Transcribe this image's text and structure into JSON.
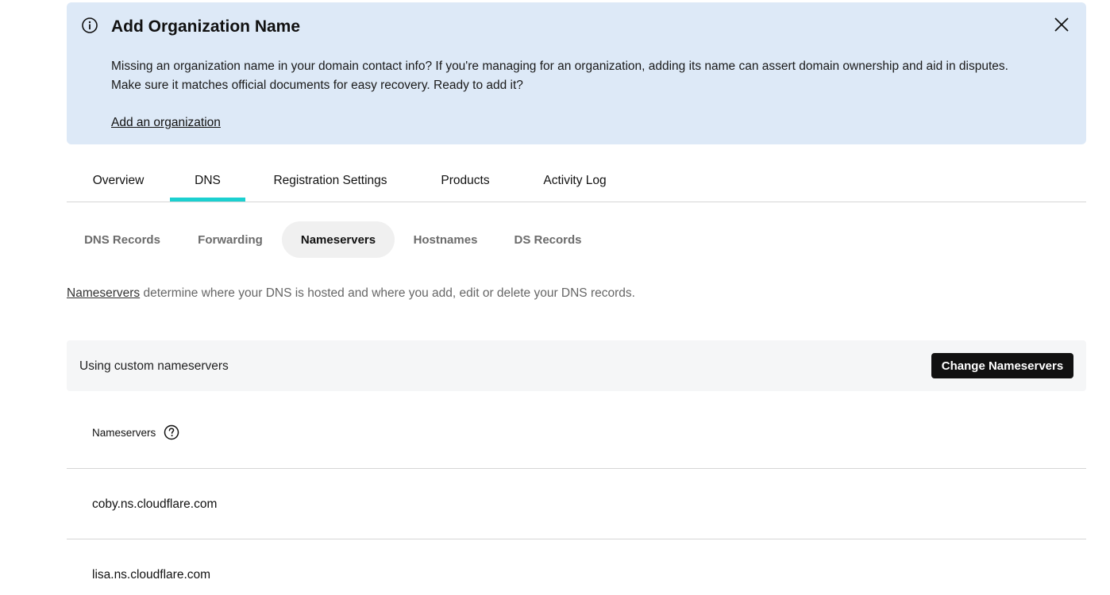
{
  "banner": {
    "title": "Add Organization Name",
    "body_line1": "Missing an organization name in your domain contact info? If you're managing for an organization, adding its name can assert domain ownership and aid in disputes.",
    "body_line2": "Make sure it matches official documents for easy recovery. Ready to add it?",
    "link": "Add an organization",
    "info_icon": "info-icon",
    "close_icon": "close-icon"
  },
  "tabs": [
    {
      "label": "Overview",
      "active": false
    },
    {
      "label": "DNS",
      "active": true
    },
    {
      "label": "Registration Settings",
      "active": false
    },
    {
      "label": "Products",
      "active": false
    },
    {
      "label": "Activity Log",
      "active": false
    }
  ],
  "subtabs": [
    {
      "label": "DNS Records",
      "active": false
    },
    {
      "label": "Forwarding",
      "active": false
    },
    {
      "label": "Nameservers",
      "active": true
    },
    {
      "label": "Hostnames",
      "active": false
    },
    {
      "label": "DS Records",
      "active": false
    }
  ],
  "description": {
    "link": "Nameservers",
    "text": " determine where your DNS is hosted and where you add, edit or delete your DNS records."
  },
  "status": {
    "label": "Using custom nameservers",
    "button": "Change Nameservers"
  },
  "nameservers": {
    "header": "Nameservers",
    "help_icon": "question-circle-icon",
    "items": [
      "coby.ns.cloudflare.com",
      "lisa.ns.cloudflare.com"
    ]
  },
  "colors": {
    "banner_bg": "#dde9f7",
    "tab_indicator": "#1bd0d0",
    "primary_button": "#111111"
  }
}
